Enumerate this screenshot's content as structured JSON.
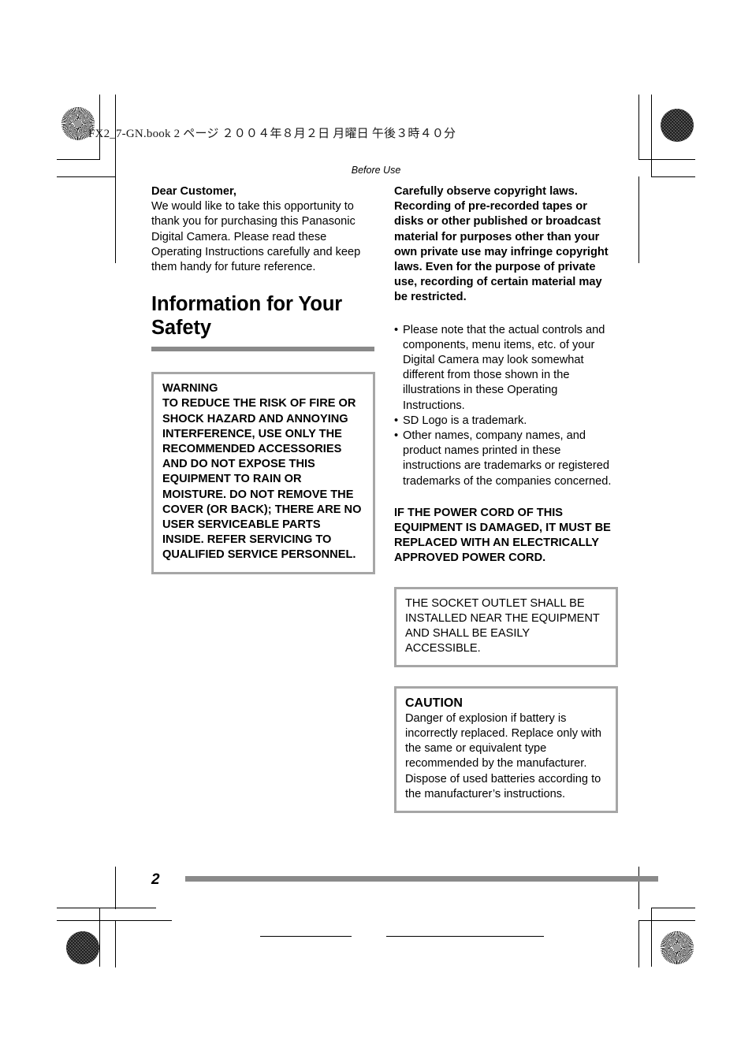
{
  "document": {
    "file_header": "FX2_7-GN.book  2 ページ  ２００４年８月２日  月曜日  午後３時４０分",
    "running_head": "Before Use",
    "page_number": "2"
  },
  "left_column": {
    "greeting_title": "Dear Customer,",
    "greeting_body": "We would like to take this opportunity to thank you for purchasing this Panasonic Digital Camera. Please read these Operating Instructions carefully and keep them handy for future reference.",
    "section_title": "Information for Your Safety",
    "warning_box": {
      "title": "WARNING",
      "body": "TO REDUCE THE RISK OF FIRE OR SHOCK HAZARD AND ANNOYING INTERFERENCE, USE ONLY THE RECOMMENDED ACCESSORIES AND DO NOT EXPOSE THIS EQUIPMENT TO RAIN OR MOISTURE. DO NOT REMOVE THE COVER (OR BACK); THERE ARE NO USER SERVICEABLE PARTS INSIDE. REFER SERVICING TO QUALIFIED SERVICE PERSONNEL."
    }
  },
  "right_column": {
    "copyright_notice": "Carefully observe copyright laws. Recording of pre-recorded tapes or disks or other published or broadcast material for purposes other than your own private use may infringe copyright laws. Even for the purpose of private use, recording of certain material may be restricted.",
    "bullets": [
      "Please note that the actual controls and components, menu items, etc. of your Digital Camera may look somewhat different from those shown in the illustrations in these Operating Instructions.",
      "SD Logo is a trademark.",
      "Other names, company names, and product names printed in these instructions are trademarks or registered trademarks of the companies concerned."
    ],
    "power_cord_notice": "IF THE POWER CORD OF THIS EQUIPMENT IS DAMAGED, IT MUST BE REPLACED WITH AN ELECTRICALLY APPROVED POWER CORD.",
    "socket_box": {
      "body": "THE SOCKET OUTLET SHALL BE INSTALLED NEAR THE EQUIPMENT AND SHALL BE EASILY ACCESSIBLE."
    },
    "caution_box": {
      "title": "CAUTION",
      "body": "Danger of explosion if battery is incorrectly replaced. Replace only with the same or equivalent type recommended by the manufacturer. Dispose of used batteries according to the manufacturer’s instructions."
    }
  },
  "colors": {
    "rule_gray": "#8a8a8a",
    "box_border_gray": "#a6a6a6",
    "text_black": "#000000",
    "page_white": "#ffffff"
  }
}
